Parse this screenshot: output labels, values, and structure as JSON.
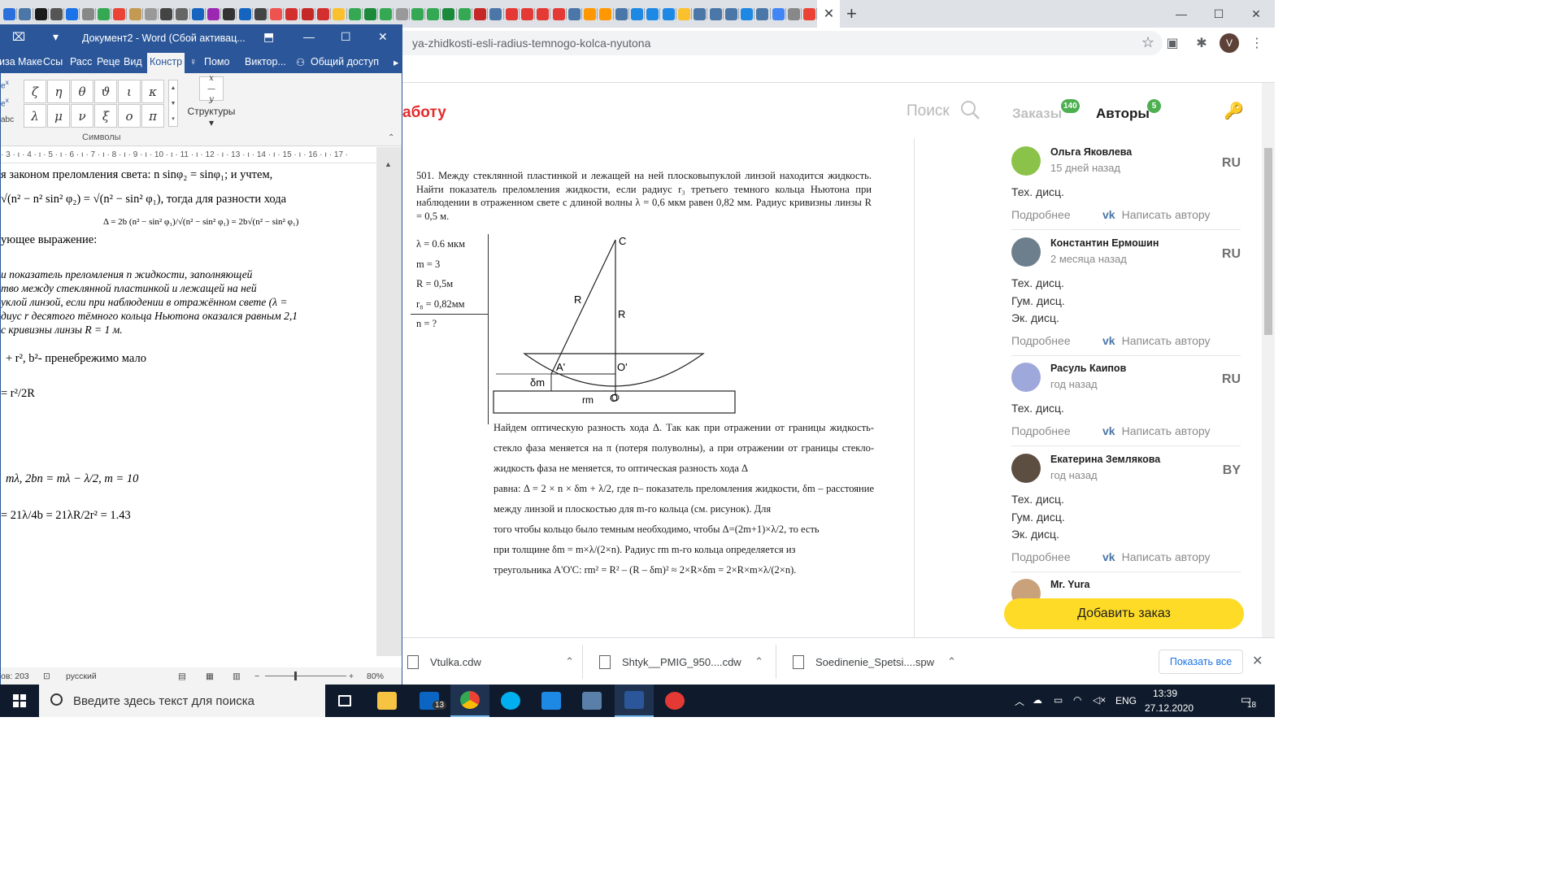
{
  "chrome": {
    "tab_close": "✕",
    "new_tab": "+",
    "favicon_colors": [
      "#2a6fdb",
      "#4a76a8",
      "#1b1b1b",
      "#555",
      "#1a73e8",
      "#888",
      "#34a853",
      "#ea4335",
      "#c49a52",
      "#999",
      "#444",
      "#666",
      "#1565c0",
      "#9c27b0",
      "#333",
      "#1565c0",
      "#444",
      "#ef5350",
      "#d32f2f",
      "#c62828",
      "#d32f2f",
      "#fbc02d",
      "#34a853",
      "#1b8a3a",
      "#34a853",
      "#999",
      "#34a853",
      "#34a853",
      "#1b8a3a",
      "#34a853",
      "#c62828",
      "#4a76a8",
      "#e53935",
      "#e53935",
      "#e53935",
      "#e53935",
      "#4a76a8",
      "#ff9800",
      "#ff9800",
      "#4a76a8",
      "#1e88e5",
      "#1e88e5",
      "#1e88e5",
      "#fbc02d",
      "#4a76a8",
      "#4a76a8",
      "#4a76a8",
      "#1e88e5",
      "#4a76a8",
      "#4285f4",
      "#888",
      "#ea4335"
    ],
    "url": "ya-zhidkosti-esli-radius-temnogo-kolca-nyutona",
    "profile_initial": "V",
    "window_controls": [
      "—",
      "☐",
      "✕"
    ]
  },
  "site": {
    "title": "аботу",
    "search_label": "Поиск",
    "tab_orders": "Заказы",
    "orders_badge": "140",
    "tab_authors": "Авторы",
    "authors_badge": "5",
    "add_order": "Добавить заказ"
  },
  "problem": {
    "text": "501. Между стеклянной пластинкой и лежащей на ней плосковыпуклой линзой находится жидкость. Найти показатель преломления жидкости, если радиус r₃ третьего темного кольца Ньютона при наблюдении в отраженном свете с длиной волны λ = 0,6 мкм равен 0,82 мм. Радиус кривизны линзы R = 0,5 м.",
    "givens": [
      "λ = 0.6 мкм",
      "m = 3",
      "R = 0,5м",
      "r₈ = 0,82мм",
      "n = ?"
    ],
    "diagram_labels": {
      "c": "C",
      "r_slant": "R",
      "r_vert": "R",
      "a": "A'",
      "o_prime": "O'",
      "delta": "δm",
      "rm": "rm",
      "o": "O"
    },
    "solution": [
      "Найдем оптическую разность хода Δ. Так как при отражении от границы жидкость-стекло фаза меняется на π (потеря полуволны), а при отражении от границы стекло-жидкость фаза не меняется, то оптическая разность хода Δ",
      "равна: Δ = 2 × n × δm + λ/2, где n– показатель преломления жидкости, δm – расстояние между линзой и плоскостью для m-го кольца (см. рисунок). Для",
      "того чтобы кольцо было темным необходимо, чтобы Δ=(2m+1)×λ/2, то есть",
      "при толщине δm = m×λ/(2×n). Радиус rm m-го кольца определяется из",
      "треугольника A'O'C: rm² = R² – (R – δm)² ≈ 2×R×δm = 2×R×m×λ/(2×n)."
    ]
  },
  "authors": [
    {
      "name": "Ольга Яковлева",
      "time": "15 дней назад",
      "country": "RU",
      "cats": [
        "Тех. дисц."
      ],
      "avatar": "#8bc34a"
    },
    {
      "name": "Константин Ермошин",
      "time": "2 месяца назад",
      "country": "RU",
      "cats": [
        "Тех. дисц.",
        "Гум. дисц.",
        "Эк. дисц."
      ],
      "avatar": "#6d7f8c"
    },
    {
      "name": "Расуль Каипов",
      "time": "год назад",
      "country": "RU",
      "cats": [
        "Тех. дисц."
      ],
      "avatar": "#9fa8da"
    },
    {
      "name": "Екатерина Землякова",
      "time": "год назад",
      "country": "BY",
      "cats": [
        "Тех. дисц.",
        "Гум. дисц.",
        "Эк. дисц."
      ],
      "avatar": "#5d4e42"
    },
    {
      "name": "Mr. Yura",
      "time": "",
      "country": "",
      "cats": [],
      "avatar": "#c9a27c"
    }
  ],
  "author_more": "Подробнее",
  "author_write": "Написать автору",
  "author_vk": "vk",
  "downloads": {
    "items": [
      "Vtulka.cdw",
      "Shtyk__PMIG_950....cdw",
      "Soedinenie_Spetsi....spw"
    ],
    "show_all": "Показать все"
  },
  "word": {
    "title": "Документ2 - Word (Сбой активац...",
    "tabs": [
      "иза",
      "Маке",
      "Ссы",
      "Расс",
      "Реце",
      "Вид",
      "Констр",
      "Помо",
      "Виктор...",
      "Общий доступ"
    ],
    "symbols": [
      "ζ",
      "η",
      "θ",
      "ϑ",
      "ι",
      "κ",
      "λ",
      "μ",
      "ν",
      "ξ",
      "ο",
      "π"
    ],
    "symbols_label": "Символы",
    "structures_label": "Структуры",
    "ruler": "· 3 · ı · 4 · ı · 5 · ı · 6 · ı · 7 · ı · 8 · ı · 9 · ı · 10 · ı · 11 · ı · 12 · ı · 13 · ı · 14 · ı · 15 · ı · 16 · ı · 17 ·",
    "doc_lines": [
      "я законом преломления света: n sinφ₂ = sinφ₁; и учтем,",
      "√(n² − n² sin² φ₂) = √(n² − sin² φ₁), тогда для разности хода",
      "Δ = 2b (n² − sin² φ₁)/√(n² − sin² φ₁) = 2b√(n² − sin² φ₁)",
      "ующее выражение:",
      "и показатель преломления n жидкости, заполняющей",
      "тво между стеклянной пластинкой и лежащей на ней",
      "уклой линзой, если при наблюдении в отражённом свете (λ =",
      "диус r десятого тёмного кольца Ньютона оказался равным 2,1",
      "с кривизны линзы R = 1 м.",
      "+ r², b²- пренебрежимо мало",
      "= r²/2R",
      "mλ, 2bn = mλ − λ/2, m = 10",
      "= 21λ/4b = 21λR/2r² = 1.43"
    ],
    "status_words": "ов: 203",
    "status_lang": "русский",
    "status_zoom": "80%"
  },
  "taskbar": {
    "search_placeholder": "Введите здесь текст для поиска",
    "mail_badge": "13",
    "lang": "ENG",
    "time": "13:39",
    "date": "27.12.2020",
    "notif_count": "18"
  }
}
